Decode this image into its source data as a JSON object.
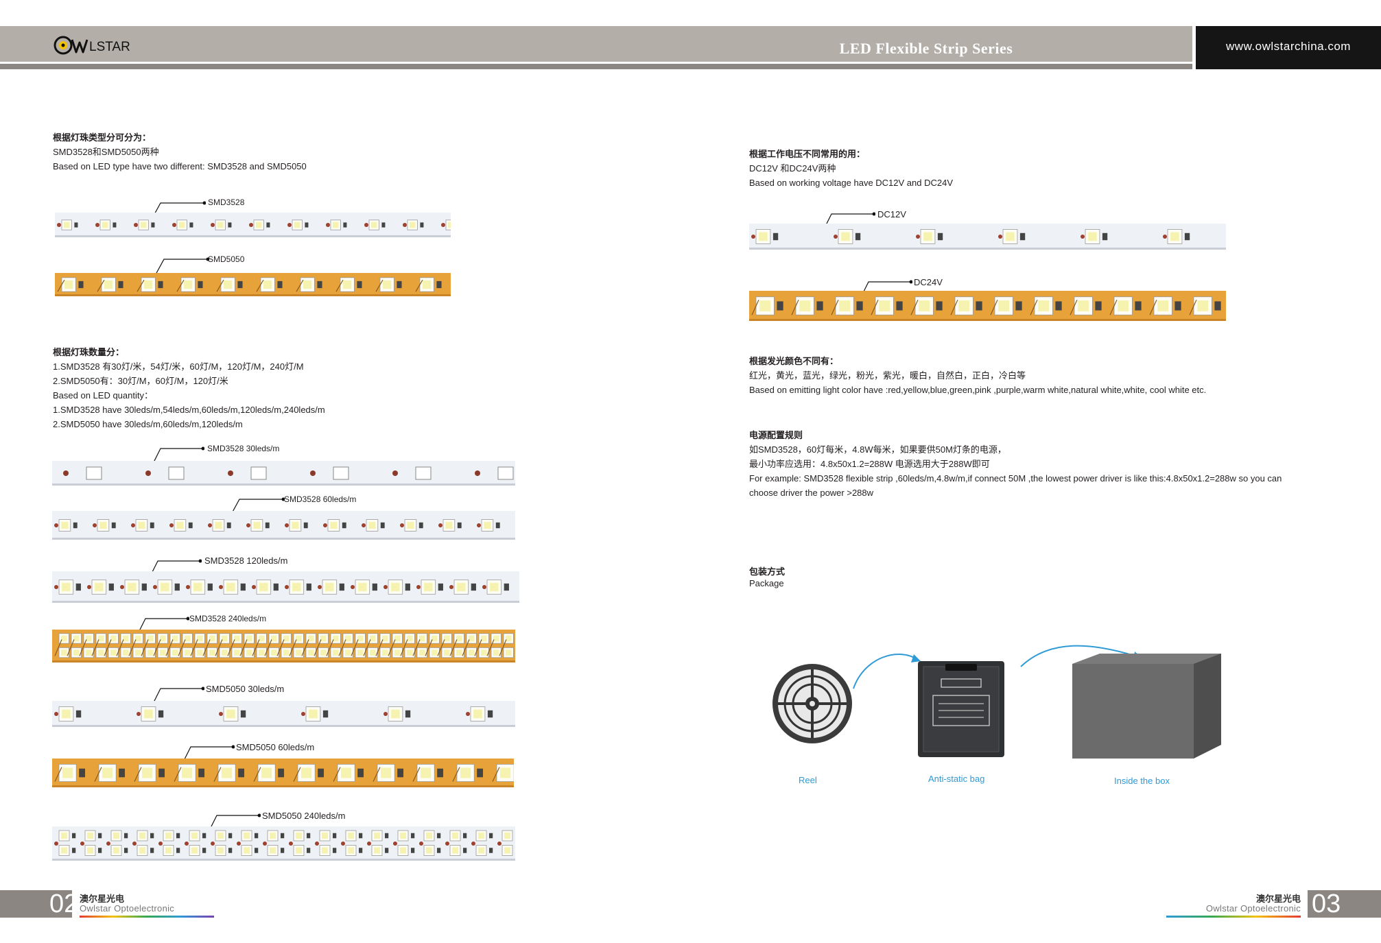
{
  "header": {
    "brand": "OWLSTAR",
    "series_title": "LED Flexible Strip Series",
    "website": "www.owlstarchina.com"
  },
  "left": {
    "led_type": {
      "heading": "根据灯珠类型分可分为：",
      "line_cn": "SMD3528和SMD5050两种",
      "line_en": "Based on LED type have two different: SMD3528 and SMD5050",
      "label_3528": "SMD3528",
      "label_5050": "SMD5050"
    },
    "quantity": {
      "heading": "根据灯珠数量分：",
      "lines": [
        "1.SMD3528 有30灯/米，54灯/米，60灯/M，120灯/M，240灯/M",
        "2.SMD5050有：30灯/M，60灯/M，120灯/米",
        "Based on LED quantity：",
        "1.SMD3528 have 30leds/m,54leds/m,60leds/m,120leds/m,240leds/m",
        "2.SMD5050 have 30leds/m,60leds/m,120leds/m"
      ]
    },
    "strip_labels": [
      "SMD3528 30leds/m",
      "SMD3528 60leds/m",
      "SMD3528 120leds/m",
      "SMD3528 240leds/m",
      "SMD5050 30leds/m",
      "SMD5050 60leds/m",
      "SMD5050 240leds/m"
    ]
  },
  "right": {
    "voltage": {
      "heading": "根据工作电压不同常用的用：",
      "line_cn": "DC12V 和DC24V两种",
      "line_en": "Based on working voltage have DC12V and DC24V",
      "label_12v": "DC12V",
      "label_24v": "DC24V"
    },
    "color": {
      "heading": "根据发光颜色不同有：",
      "line_cn": "红光，黄光，蓝光，绿光，粉光，紫光，暖白，自然白，正白，冷白等",
      "line_en": "Based on emitting light color have :red,yellow,blue,green,pink ,purple,warm white,natural white,white, cool white etc."
    },
    "power": {
      "heading": "电源配置规则",
      "lines": [
        "如SMD3528，60灯每米，4.8W每米，如果要供50M灯条的电源，",
        "最小功率应选用：4.8x50x1.2=288W  电源选用大于288W即可",
        "For example: SMD3528 flexible strip ,60leds/m,4.8w/m,if connect 50M ,the lowest power driver is like this:4.8x50x1.2=288w  so you can",
        "choose driver the power >288w"
      ]
    },
    "package": {
      "heading_cn": "包装方式",
      "heading_en": "Package",
      "reel": "Reel",
      "bag": "Anti-static bag",
      "box": "Inside the box"
    }
  },
  "footer": {
    "left_num": "02",
    "right_num": "03",
    "company_cn": "澳尔星光电",
    "company_en": "Owlstar Optoelectronic"
  },
  "colors": {
    "header_band": "#b3aea8",
    "header_dark": "#151515",
    "strip_white": "#eef1f5",
    "strip_orange": "#e8a23a",
    "package_blue": "#2e9ad6",
    "box_gray": "#6b6b6b"
  }
}
